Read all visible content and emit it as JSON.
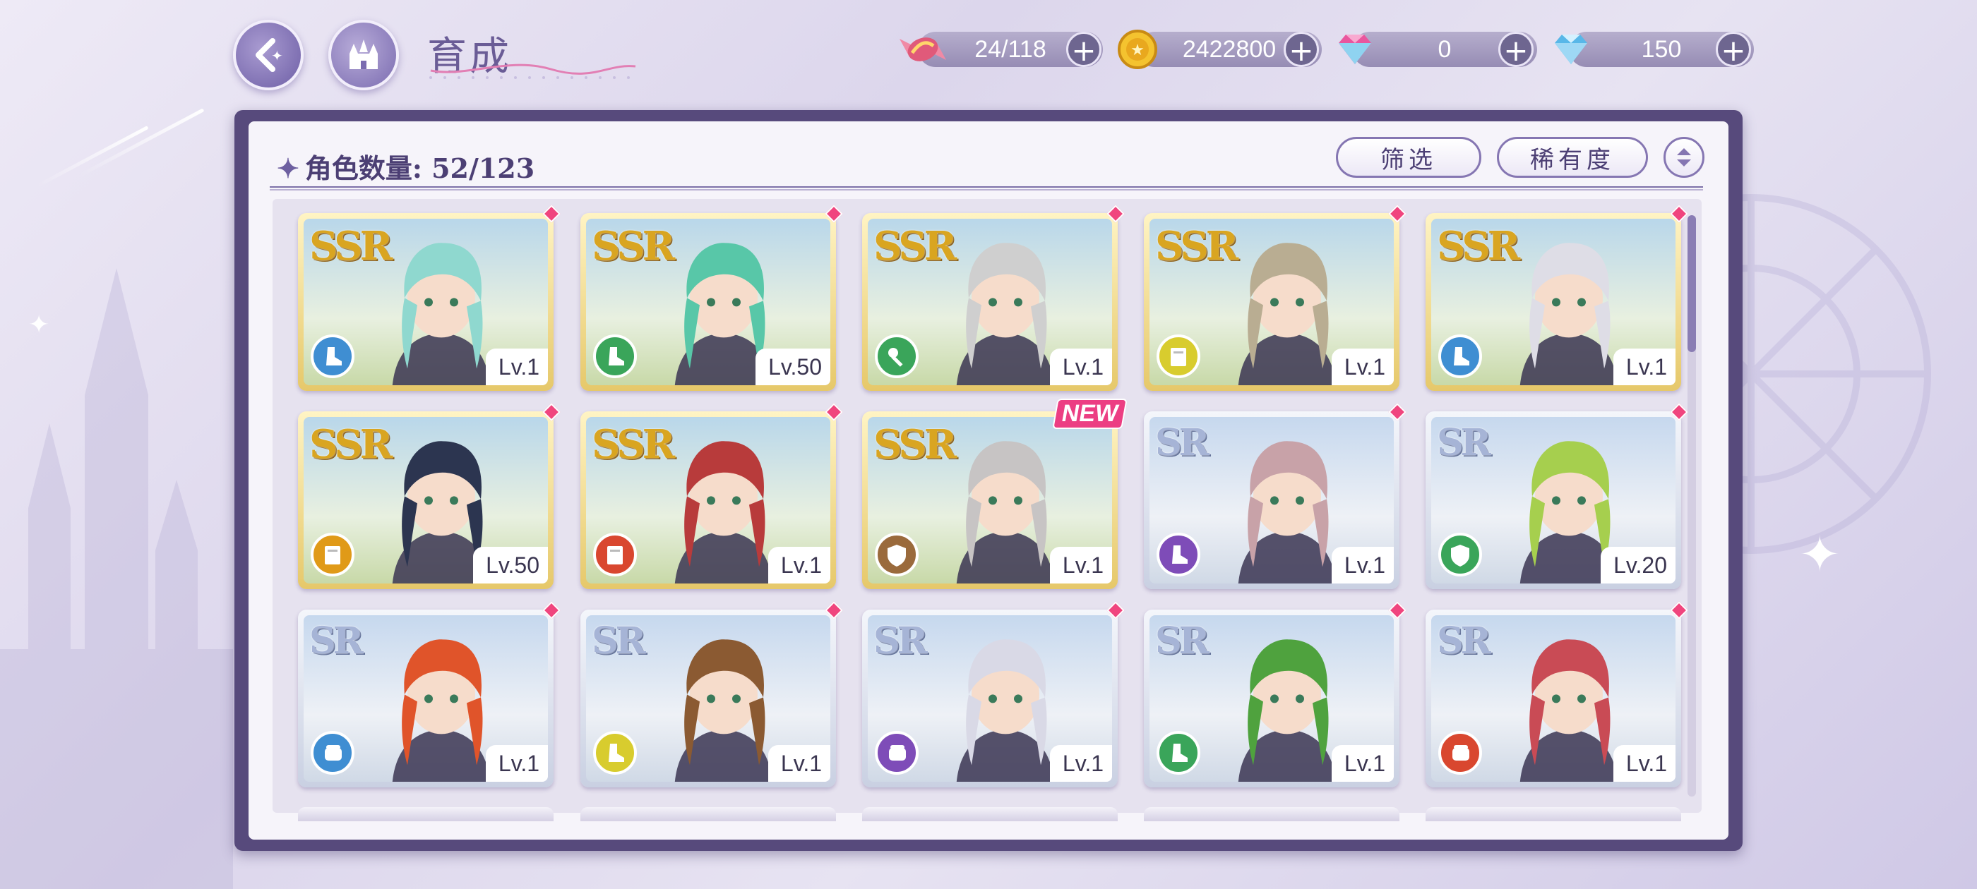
{
  "header": {
    "title": "育成",
    "resources": [
      {
        "name": "candy",
        "value": "24/118",
        "color": "#e05a7a"
      },
      {
        "name": "gold-coin",
        "value": "2422800",
        "color": "#e0a820"
      },
      {
        "name": "pink-gem",
        "value": "0",
        "color": "#e9569e"
      },
      {
        "name": "blue-gem",
        "value": "150",
        "color": "#58b7e8"
      }
    ]
  },
  "panel": {
    "count_label": "角色数量: 52/123",
    "filter_label": "筛选",
    "sort_label": "稀有度"
  },
  "cards": [
    {
      "rarity": "SSR",
      "level": "Lv.1",
      "class_color": "#3f8ed2",
      "class_icon": "boot-icon",
      "hair": "#8fd8cf",
      "new": false
    },
    {
      "rarity": "SSR",
      "level": "Lv.50",
      "class_color": "#3aa55a",
      "class_icon": "boot-icon",
      "hair": "#58c7a8",
      "new": false
    },
    {
      "rarity": "SSR",
      "level": "Lv.1",
      "class_color": "#3aa55a",
      "class_icon": "wand-icon",
      "hair": "#cfcfcf",
      "new": false
    },
    {
      "rarity": "SSR",
      "level": "Lv.1",
      "class_color": "#d8cc2e",
      "class_icon": "book-icon",
      "hair": "#b9ad92",
      "new": false
    },
    {
      "rarity": "SSR",
      "level": "Lv.1",
      "class_color": "#3f8ed2",
      "class_icon": "boot-icon",
      "hair": "#dedde6",
      "new": false
    },
    {
      "rarity": "SSR",
      "level": "Lv.50",
      "class_color": "#e09a18",
      "class_icon": "book-icon",
      "hair": "#2c3550",
      "new": false
    },
    {
      "rarity": "SSR",
      "level": "Lv.1",
      "class_color": "#d9472f",
      "class_icon": "book-icon",
      "hair": "#b83b3b",
      "new": false
    },
    {
      "rarity": "SSR",
      "level": "Lv.1",
      "class_color": "#9a6a3c",
      "class_icon": "shield-icon",
      "hair": "#c7c4c4",
      "new": true
    },
    {
      "rarity": "SR",
      "level": "Lv.1",
      "class_color": "#7e4cb8",
      "class_icon": "boot-icon",
      "hair": "#c8a2a8",
      "new": false
    },
    {
      "rarity": "SR",
      "level": "Lv.20",
      "class_color": "#3aa55a",
      "class_icon": "shield-icon",
      "hair": "#a6cf4e",
      "new": false
    },
    {
      "rarity": "SR",
      "level": "Lv.1",
      "class_color": "#3f8ed2",
      "class_icon": "fist-icon",
      "hair": "#e0542a",
      "new": false
    },
    {
      "rarity": "SR",
      "level": "Lv.1",
      "class_color": "#d8cc2e",
      "class_icon": "boot-icon",
      "hair": "#8b5a32",
      "new": false
    },
    {
      "rarity": "SR",
      "level": "Lv.1",
      "class_color": "#7e4cb8",
      "class_icon": "fist-icon",
      "hair": "#d9d9e6",
      "new": false
    },
    {
      "rarity": "SR",
      "level": "Lv.1",
      "class_color": "#3aa55a",
      "class_icon": "boot-icon",
      "hair": "#4fa23e",
      "new": false
    },
    {
      "rarity": "SR",
      "level": "Lv.1",
      "class_color": "#d9472f",
      "class_icon": "fist-icon",
      "hair": "#c94b55",
      "new": false
    }
  ],
  "new_badge": "NEW"
}
